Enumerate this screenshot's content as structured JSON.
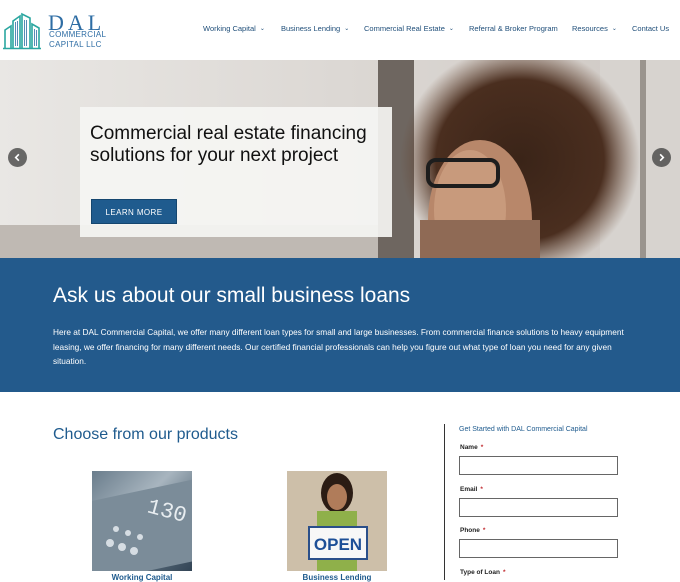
{
  "logo": {
    "name": "DAL",
    "sub_line1": "COMMERCIAL",
    "sub_line2": "CAPITAL LLC"
  },
  "nav": {
    "items": [
      {
        "label": "Working Capital",
        "dropdown": true
      },
      {
        "label": "Business Lending",
        "dropdown": true
      },
      {
        "label": "Commercial Real Estate",
        "dropdown": true
      },
      {
        "label": "Referral & Broker Program",
        "dropdown": false
      },
      {
        "label": "Resources",
        "dropdown": true
      },
      {
        "label": "Contact Us",
        "dropdown": false
      }
    ],
    "chevron": "⌄"
  },
  "hero": {
    "title": "Commercial real estate financing solutions for your next project",
    "button_label": "LEARN MORE"
  },
  "banner": {
    "title": "Ask us about our small business loans",
    "text": "Here at DAL Commercial Capital, we offer many different loan types for small and large businesses. From commercial finance solutions to heavy equipment leasing, we offer financing for many different needs. Our certified financial professionals can help you figure out what type of loan you need for any given situation."
  },
  "products": {
    "title": "Choose from our products",
    "items": [
      {
        "label": "Working Capital",
        "image_text": "130"
      },
      {
        "label": "Business Lending",
        "image_text": "OPEN"
      }
    ]
  },
  "form": {
    "heading": "Get Started with DAL Commercial Capital",
    "required_mark": "*",
    "fields": [
      {
        "label": "Name",
        "value": ""
      },
      {
        "label": "Email",
        "value": ""
      },
      {
        "label": "Phone",
        "value": ""
      },
      {
        "label": "Type of Loan",
        "value": ""
      }
    ]
  },
  "colors": {
    "brand": "#1f5b8e",
    "banner": "#235a8c",
    "required": "#c0282d"
  }
}
